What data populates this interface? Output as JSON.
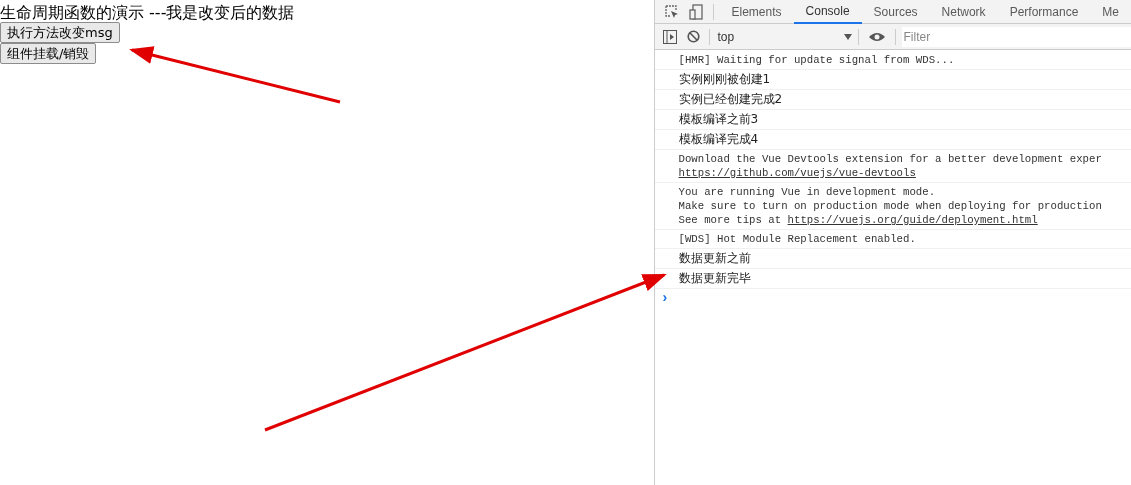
{
  "page": {
    "heading": "生命周期函数的演示 ---我是改变后的数据",
    "buttons": [
      "执行方法改变msg",
      "组件挂载/销毁"
    ]
  },
  "devtools": {
    "tabs": [
      {
        "label": "Elements",
        "selected": false
      },
      {
        "label": "Console",
        "selected": true
      },
      {
        "label": "Sources",
        "selected": false
      },
      {
        "label": "Network",
        "selected": false
      },
      {
        "label": "Performance",
        "selected": false
      },
      {
        "label": "Me",
        "selected": false
      }
    ],
    "context": "top",
    "filter_placeholder": "Filter",
    "messages": [
      {
        "kind": "code",
        "lines": [
          {
            "text": "[HMR] Waiting for update signal from WDS..."
          }
        ]
      },
      {
        "kind": "plain",
        "lines": [
          {
            "text": "实例刚刚被创建1"
          }
        ]
      },
      {
        "kind": "plain",
        "lines": [
          {
            "text": "实例已经创建完成2"
          }
        ]
      },
      {
        "kind": "plain",
        "lines": [
          {
            "text": "模板编译之前3"
          }
        ]
      },
      {
        "kind": "plain",
        "lines": [
          {
            "text": "模板编译完成4"
          }
        ]
      },
      {
        "kind": "code",
        "lines": [
          {
            "text": "Download the Vue Devtools extension for a better development exper"
          },
          {
            "link": "https://github.com/vuejs/vue-devtools"
          }
        ]
      },
      {
        "kind": "code",
        "lines": [
          {
            "text": "You are running Vue in development mode."
          },
          {
            "text": "Make sure to turn on production mode when deploying for production"
          },
          {
            "text": "See more tips at",
            "link": "https://vuejs.org/guide/deployment.html"
          }
        ]
      },
      {
        "kind": "code",
        "lines": [
          {
            "text": "[WDS] Hot Module Replacement enabled."
          }
        ]
      },
      {
        "kind": "plain",
        "lines": [
          {
            "text": "数据更新之前"
          }
        ]
      },
      {
        "kind": "plain",
        "lines": [
          {
            "text": "数据更新完毕"
          }
        ]
      }
    ],
    "prompt": "›"
  }
}
